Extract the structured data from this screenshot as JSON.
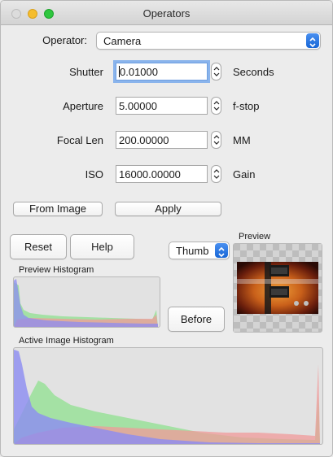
{
  "window": {
    "title": "Operators"
  },
  "operator": {
    "label": "Operator:",
    "selected": "Camera"
  },
  "params": [
    {
      "label": "Shutter",
      "value": "0.01000",
      "unit": "Seconds"
    },
    {
      "label": "Aperture",
      "value": "5.00000",
      "unit": "f-stop"
    },
    {
      "label": "Focal Len",
      "value": "200.00000",
      "unit": "MM"
    },
    {
      "label": "ISO",
      "value": "16000.00000",
      "unit": "Gain"
    }
  ],
  "buttons": {
    "from_image": "From Image",
    "apply": "Apply",
    "reset": "Reset",
    "help": "Help",
    "before": "Before"
  },
  "preview": {
    "label": "Preview",
    "mode": "Thumb"
  },
  "histograms": {
    "preview_label": "Preview Histogram",
    "active_label": "Active Image Histogram"
  },
  "colors": {
    "accent": "#1766d6",
    "hist_red": "#f09a9a",
    "hist_green": "#8fe08f",
    "hist_blue": "#8c8cf2"
  }
}
